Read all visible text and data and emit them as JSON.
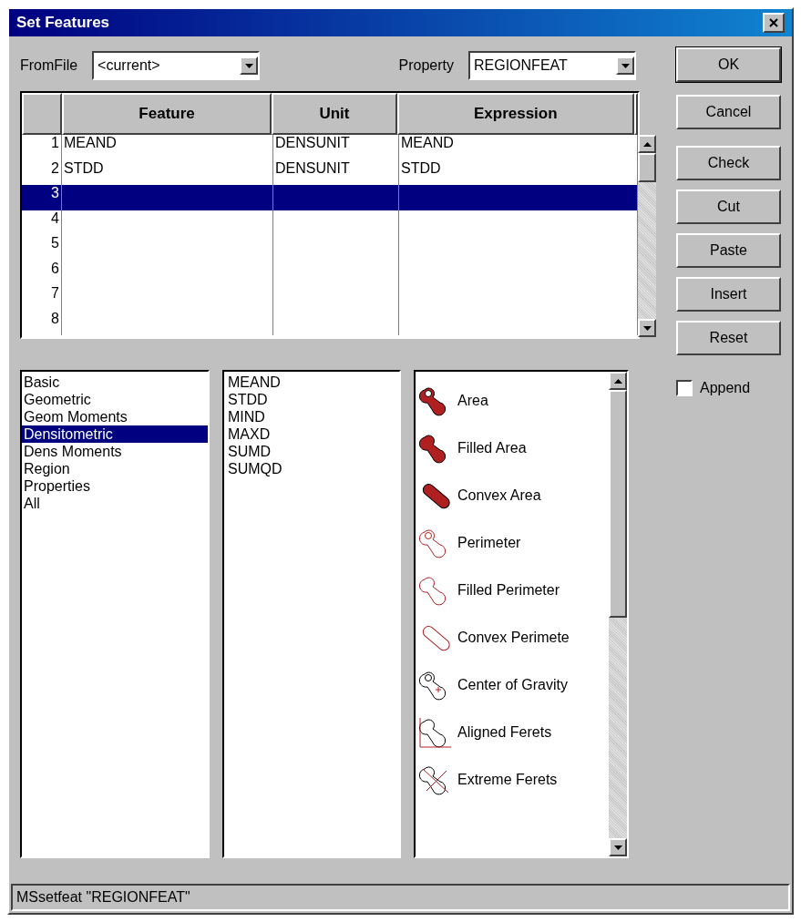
{
  "window": {
    "title": "Set Features"
  },
  "from_file": {
    "label": "FromFile",
    "value": "<current>"
  },
  "property": {
    "label": "Property",
    "value": "REGIONFEAT"
  },
  "table": {
    "columns": [
      "Feature",
      "Unit",
      "Expression"
    ],
    "rows": [
      {
        "number": "1",
        "feature": "MEAND",
        "unit": "DENSUNIT",
        "expression": "MEAND",
        "selected": false
      },
      {
        "number": "2",
        "feature": "STDD",
        "unit": "DENSUNIT",
        "expression": "STDD",
        "selected": false
      },
      {
        "number": "3",
        "selected": true
      },
      {
        "number": "4",
        "selected": false
      },
      {
        "number": "5",
        "selected": false
      },
      {
        "number": "6",
        "selected": false
      },
      {
        "number": "7",
        "selected": false
      },
      {
        "number": "8",
        "selected": false
      }
    ]
  },
  "categories": [
    {
      "label": "Basic",
      "selected": false
    },
    {
      "label": "Geometric",
      "selected": false
    },
    {
      "label": "Geom Moments",
      "selected": false
    },
    {
      "label": "Densitometric",
      "selected": true
    },
    {
      "label": "Dens Moments",
      "selected": false
    },
    {
      "label": "Region",
      "selected": false
    },
    {
      "label": "Properties",
      "selected": false
    },
    {
      "label": "All",
      "selected": false
    }
  ],
  "features": [
    "MEAND",
    "STDD",
    "MIND",
    "MAXD",
    "SUMD",
    "SUMQD"
  ],
  "measures": [
    "Area",
    "Filled Area",
    "Convex Area",
    "Perimeter",
    "Filled Perimeter",
    "Convex Perimete",
    "Center of Gravity",
    "Aligned Ferets",
    "Extreme Ferets"
  ],
  "buttons": [
    "OK",
    "Cancel",
    "Check",
    "Cut",
    "Paste",
    "Insert",
    "Reset"
  ],
  "append": {
    "label": "Append",
    "checked": false
  },
  "status_bar": "MSsetfeat \"REGIONFEAT\""
}
